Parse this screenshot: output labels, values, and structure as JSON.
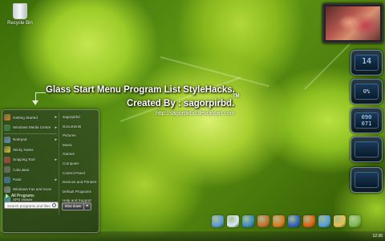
{
  "desktop": {
    "recycle_bin_label": "Recycle Bin"
  },
  "overlay": {
    "title_line1": "Glass Start Menu Program List StyleHacks.",
    "title_line2": "Created By : sagorpirbd.",
    "trademark": "TM",
    "url": "http://sagorpirbd.deviantart.com"
  },
  "start_menu": {
    "programs": [
      {
        "label": "Getting Started",
        "color": "#e07a20",
        "has_submenu": true
      },
      {
        "label": "Windows Media Center",
        "color": "#2f7a3a",
        "has_submenu": true
      },
      {
        "label": "Notepad",
        "color": "#5f8fd0",
        "has_submenu": true
      },
      {
        "label": "Sticky Notes",
        "color": "#e0c030",
        "has_submenu": false
      },
      {
        "label": "Snipping Tool",
        "color": "#c03030",
        "has_submenu": true
      },
      {
        "label": "Calculator",
        "color": "#6a6a6a",
        "has_submenu": false
      },
      {
        "label": "Paint",
        "color": "#3070c0",
        "has_submenu": true
      },
      {
        "label": "Windows Fax and Scan",
        "color": "#808890",
        "has_submenu": false
      },
      {
        "label": "XPS Viewer",
        "color": "#3aa0c0",
        "has_submenu": false
      }
    ],
    "all_programs": "All Programs",
    "search_placeholder": "Search programs and files",
    "right_items": [
      "sagorpirbd",
      "Documents",
      "Pictures",
      "Music",
      "Games",
      "Computer",
      "Control Panel",
      "Devices and Printers",
      "Default Programs",
      "Help and Support",
      "Run..."
    ],
    "shutdown_label": "Shut down",
    "shutdown_arrow": "▸"
  },
  "gadgets": {
    "gadget1_value": "14",
    "gadget2_value": "0%",
    "gadget3_line1": "090",
    "gadget3_line2": "071"
  },
  "taskbar": {
    "clock": "12:36",
    "icons": [
      {
        "name": "computer-icon",
        "color": "#5a9ad8"
      },
      {
        "name": "notepad-icon",
        "color": "#d8e8f8"
      },
      {
        "name": "media-player-icon",
        "color": "#3a8ac8"
      },
      {
        "name": "photos-icon",
        "color": "#c86a30"
      },
      {
        "name": "firefox-icon",
        "color": "#e07820"
      },
      {
        "name": "messenger-icon",
        "color": "#3060c0"
      },
      {
        "name": "planet-icon",
        "color": "#e06010"
      },
      {
        "name": "globe-icon",
        "color": "#50a0e0"
      },
      {
        "name": "folder-icon",
        "color": "#e8c050"
      },
      {
        "name": "recycle-icon",
        "color": "#7ab850"
      }
    ]
  }
}
